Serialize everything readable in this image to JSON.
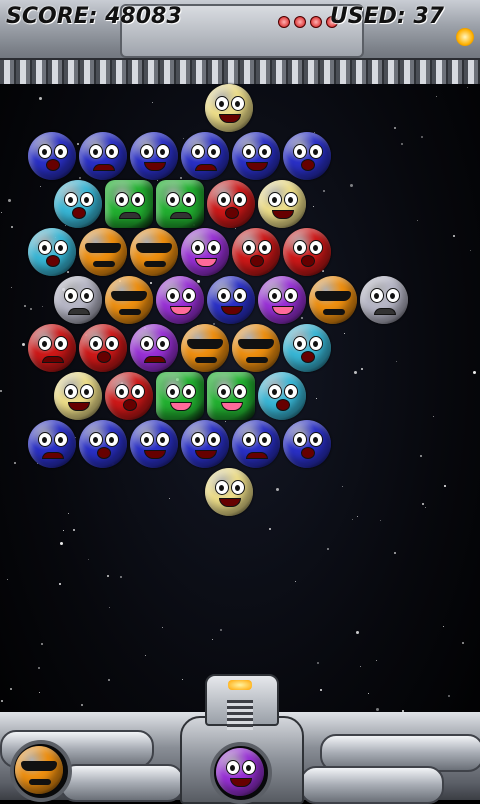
{
  "hud": {
    "score_label": "SCORE: 48083",
    "used_label": "USED: 37"
  },
  "colors": {
    "blue": "#2a30c8",
    "cyan": "#38b8d8",
    "green": "#22b030",
    "red": "#d01818",
    "yellow": "#f0e08a",
    "orange": "#f09010",
    "purple": "#9a30d8",
    "grey": "#b8b8c8"
  },
  "bubbles": [
    {
      "row": 0,
      "col": 4,
      "color": "yellow",
      "face": "smug"
    },
    {
      "row": 1,
      "col": 0,
      "color": "blue",
      "face": "scared"
    },
    {
      "row": 1,
      "col": 1,
      "color": "blue",
      "face": "angry"
    },
    {
      "row": 1,
      "col": 2,
      "color": "blue",
      "face": "grin"
    },
    {
      "row": 1,
      "col": 3,
      "color": "blue",
      "face": "angry"
    },
    {
      "row": 1,
      "col": 4,
      "color": "blue",
      "face": "grin"
    },
    {
      "row": 1,
      "col": 5,
      "color": "blue",
      "face": "scared"
    },
    {
      "row": 2,
      "col": 0,
      "color": "cyan",
      "face": "cry"
    },
    {
      "row": 2,
      "col": 1,
      "color": "green",
      "face": "frown",
      "shape": "square"
    },
    {
      "row": 2,
      "col": 2,
      "color": "green",
      "face": "frown",
      "shape": "square"
    },
    {
      "row": 2,
      "col": 3,
      "color": "red",
      "face": "scared"
    },
    {
      "row": 2,
      "col": 4,
      "color": "yellow",
      "face": "smug"
    },
    {
      "row": 3,
      "col": 0,
      "color": "cyan",
      "face": "cry"
    },
    {
      "row": 3,
      "col": 1,
      "color": "orange",
      "face": "shades"
    },
    {
      "row": 3,
      "col": 2,
      "color": "orange",
      "face": "shades"
    },
    {
      "row": 3,
      "col": 3,
      "color": "purple",
      "face": "tongue"
    },
    {
      "row": 3,
      "col": 4,
      "color": "red",
      "face": "scared"
    },
    {
      "row": 3,
      "col": 5,
      "color": "red",
      "face": "scared"
    },
    {
      "row": 4,
      "col": 0,
      "color": "grey",
      "face": "frown"
    },
    {
      "row": 4,
      "col": 1,
      "color": "orange",
      "face": "shades"
    },
    {
      "row": 4,
      "col": 2,
      "color": "purple",
      "face": "tongue"
    },
    {
      "row": 4,
      "col": 3,
      "color": "blue",
      "face": "grin"
    },
    {
      "row": 4,
      "col": 4,
      "color": "purple",
      "face": "tongue"
    },
    {
      "row": 4,
      "col": 5,
      "color": "orange",
      "face": "shades"
    },
    {
      "row": 4,
      "col": 6,
      "color": "grey",
      "face": "frown"
    },
    {
      "row": 5,
      "col": 0,
      "color": "red",
      "face": "angry"
    },
    {
      "row": 5,
      "col": 1,
      "color": "red",
      "face": "scared"
    },
    {
      "row": 5,
      "col": 2,
      "color": "purple",
      "face": "angry"
    },
    {
      "row": 5,
      "col": 3,
      "color": "orange",
      "face": "shades"
    },
    {
      "row": 5,
      "col": 4,
      "color": "orange",
      "face": "shades"
    },
    {
      "row": 5,
      "col": 5,
      "color": "cyan",
      "face": "cry"
    },
    {
      "row": 6,
      "col": 0,
      "color": "yellow",
      "face": "smug"
    },
    {
      "row": 6,
      "col": 1,
      "color": "red",
      "face": "scared"
    },
    {
      "row": 6,
      "col": 2,
      "color": "green",
      "face": "tongue",
      "shape": "square"
    },
    {
      "row": 6,
      "col": 3,
      "color": "green",
      "face": "tongue",
      "shape": "square"
    },
    {
      "row": 6,
      "col": 4,
      "color": "cyan",
      "face": "cry"
    },
    {
      "row": 7,
      "col": 0,
      "color": "blue",
      "face": "angry"
    },
    {
      "row": 7,
      "col": 1,
      "color": "blue",
      "face": "scared"
    },
    {
      "row": 7,
      "col": 2,
      "color": "blue",
      "face": "grin"
    },
    {
      "row": 7,
      "col": 3,
      "color": "blue",
      "face": "grin"
    },
    {
      "row": 7,
      "col": 4,
      "color": "blue",
      "face": "angry"
    },
    {
      "row": 7,
      "col": 5,
      "color": "blue",
      "face": "scared"
    },
    {
      "row": 8,
      "col": 2,
      "color": "yellow",
      "face": "smug"
    }
  ],
  "launcher": {
    "current_color": "purple",
    "current_face": "grin",
    "next_color": "orange",
    "next_face": "shades"
  }
}
